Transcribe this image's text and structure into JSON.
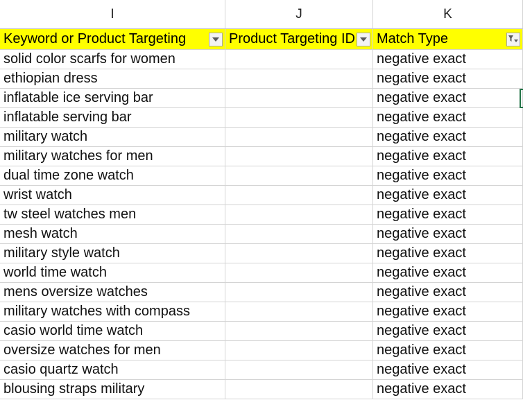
{
  "column_letters": [
    "I",
    "J",
    "K"
  ],
  "headers": [
    {
      "label": "Keyword or Product Targeting",
      "filter_icon": "dropdown-arrow"
    },
    {
      "label": "Product Targeting ID",
      "filter_icon": "dropdown-arrow"
    },
    {
      "label": "Match Type",
      "filter_icon": "filter-active"
    }
  ],
  "header_fill": "#ffff00",
  "rows": [
    {
      "keyword": "solid color scarfs for women",
      "product_id": "",
      "match_type": "negative exact"
    },
    {
      "keyword": "ethiopian dress",
      "product_id": "",
      "match_type": "negative exact"
    },
    {
      "keyword": "inflatable ice serving bar",
      "product_id": "",
      "match_type": "negative exact"
    },
    {
      "keyword": "inflatable serving bar",
      "product_id": "",
      "match_type": "negative exact"
    },
    {
      "keyword": "military watch",
      "product_id": "",
      "match_type": "negative exact"
    },
    {
      "keyword": "military watches for men",
      "product_id": "",
      "match_type": "negative exact"
    },
    {
      "keyword": "dual time zone watch",
      "product_id": "",
      "match_type": "negative exact"
    },
    {
      "keyword": "wrist watch",
      "product_id": "",
      "match_type": "negative exact"
    },
    {
      "keyword": "tw steel watches men",
      "product_id": "",
      "match_type": "negative exact"
    },
    {
      "keyword": "mesh watch",
      "product_id": "",
      "match_type": "negative exact"
    },
    {
      "keyword": "military style watch",
      "product_id": "",
      "match_type": "negative exact"
    },
    {
      "keyword": "world time watch",
      "product_id": "",
      "match_type": "negative exact"
    },
    {
      "keyword": "mens oversize watches",
      "product_id": "",
      "match_type": "negative exact"
    },
    {
      "keyword": "military watches with compass",
      "product_id": "",
      "match_type": "negative exact"
    },
    {
      "keyword": "casio world time watch",
      "product_id": "",
      "match_type": "negative exact"
    },
    {
      "keyword": "oversize watches for men",
      "product_id": "",
      "match_type": "negative exact"
    },
    {
      "keyword": "casio quartz watch",
      "product_id": "",
      "match_type": "negative exact"
    },
    {
      "keyword": "blousing straps military",
      "product_id": "",
      "match_type": "negative exact"
    }
  ]
}
